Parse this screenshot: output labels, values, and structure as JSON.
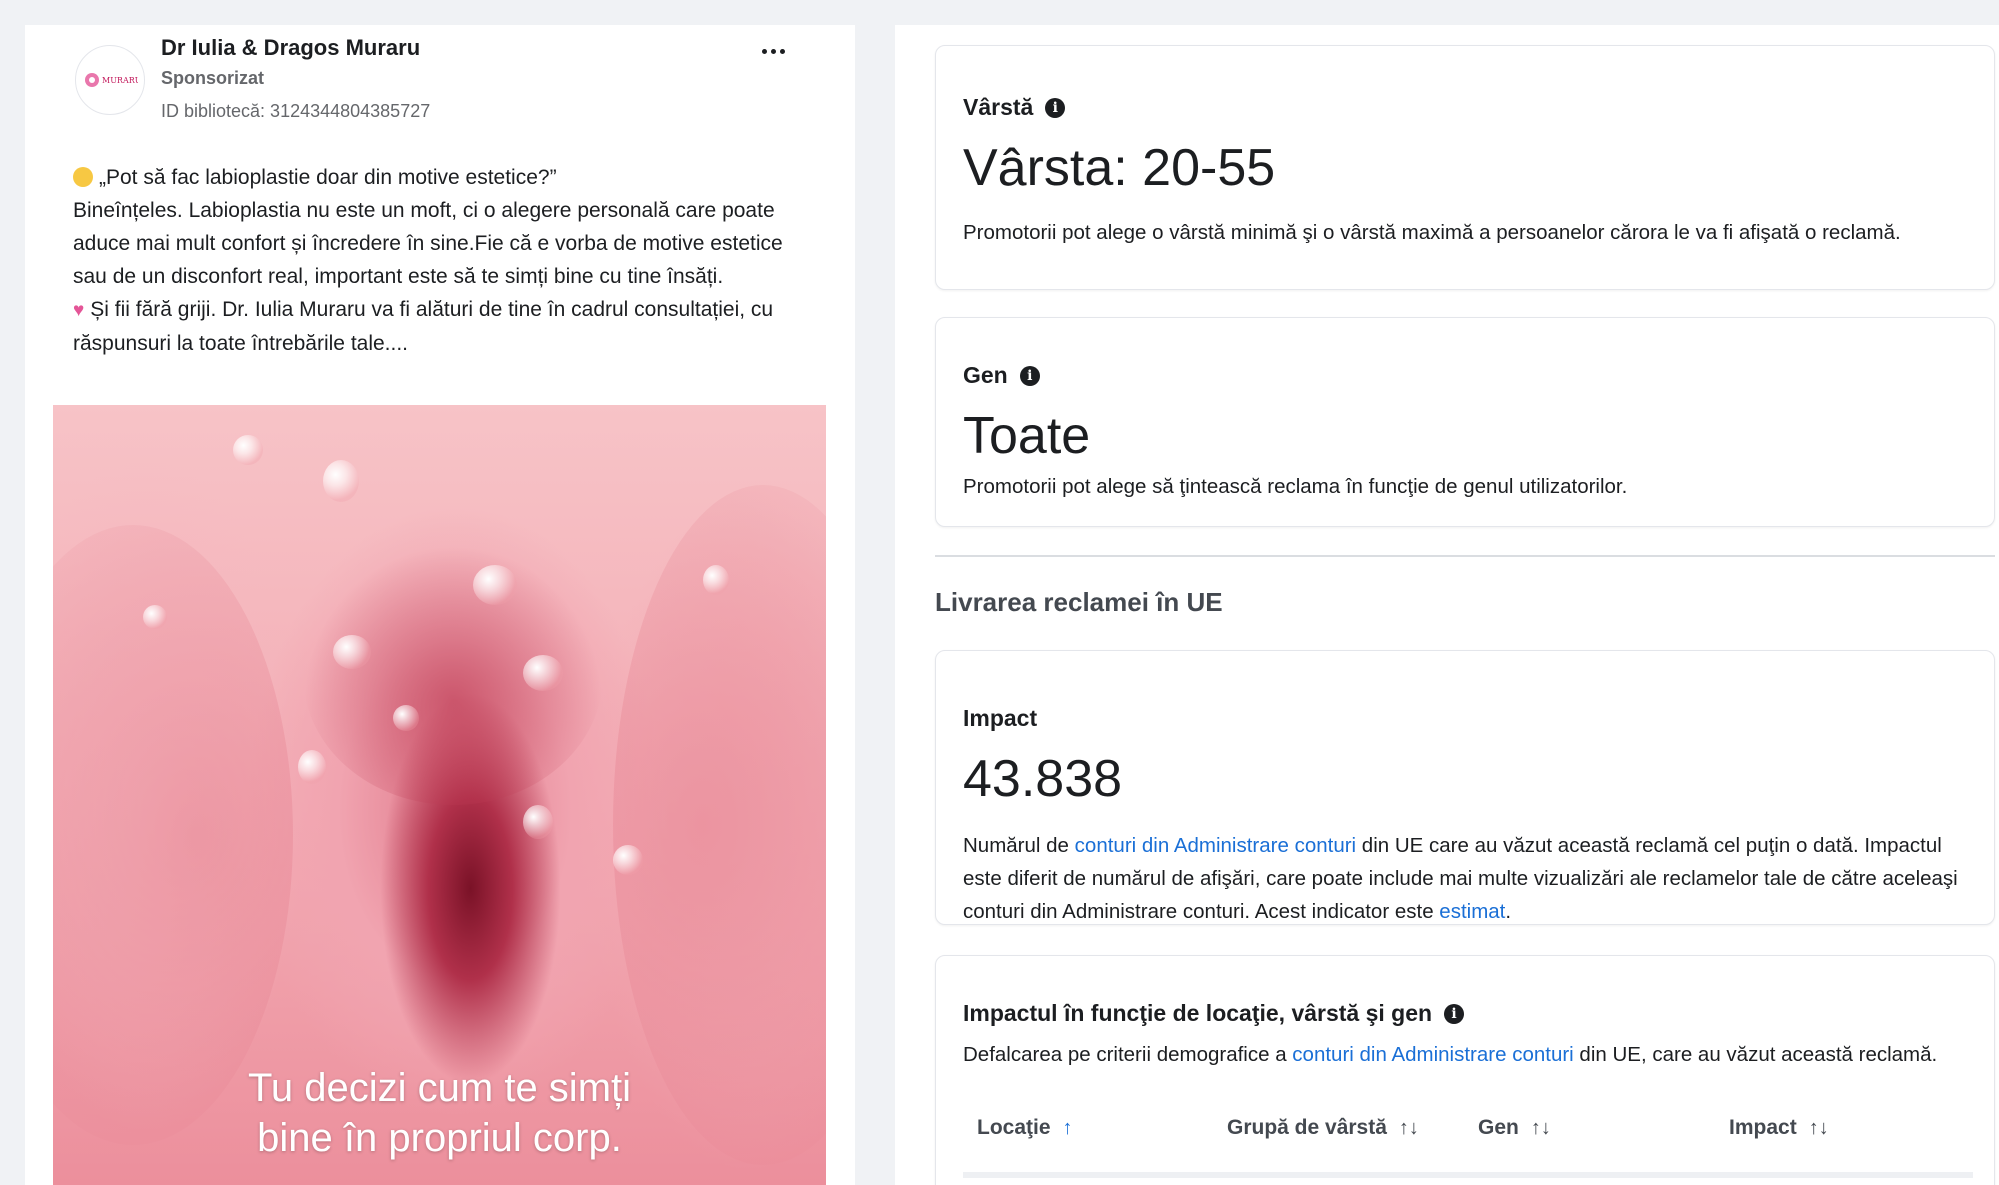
{
  "ad": {
    "page_name": "Dr Iulia & Dragos Muraru",
    "sponsored_label": "Sponsorizat",
    "library_id": "ID bibliotecă: 3124344804385727",
    "avatar_text": "MURARU",
    "line1": "„Pot să fac labioplastie doar din motive estetice?”",
    "line2": "Bineînțeles. Labioplastia nu este un moft, ci o alegere personală care poate aduce mai mult confort și încredere în sine.Fie că e vorba de motive estetice sau de un disconfort real, important este să te simți bine cu tine însăți.",
    "line3": "Și fii fără griji. Dr. Iulia Muraru va fi alături de tine în cadrul consultației, cu răspunsuri la toate întrebările tale....",
    "emoji1": "thinking-face",
    "emoji2": "pink-heart",
    "image_caption_line1": "Tu decizi cum te simți",
    "image_caption_line2": "bine în propriul corp."
  },
  "age": {
    "label": "Vârstă",
    "value": "Vârsta: 20-55",
    "description": "Promotorii pot alege o vârstă minimă şi o vârstă maximă a persoanelor cărora le va fi afişată o reclamă."
  },
  "gender": {
    "label": "Gen",
    "value": "Toate",
    "description": "Promotorii pot alege să ţintească reclama în funcţie de genul utilizatorilor."
  },
  "eu_delivery": {
    "title": "Livrarea reclamei în UE"
  },
  "impact": {
    "label": "Impact",
    "value": "43.838",
    "desc_part1": "Numărul de ",
    "desc_link1": "conturi din Administrare conturi",
    "desc_part2": " din UE care au văzut această reclamă cel puţin o dată. Impactul este diferit de numărul de afişări, care poate include mai multe vizualizări ale reclamelor tale de către aceleaşi conturi din Administrare conturi. Acest indicator este ",
    "desc_link2": "estimat",
    "desc_part3": "."
  },
  "breakdown": {
    "title": "Impactul în funcţie de locaţie, vârstă şi gen",
    "desc_part1": "Defalcarea pe criterii demografice a ",
    "desc_link": "conturi din Administrare conturi",
    "desc_part2": " din UE, care au văzut această reclamă.",
    "columns": [
      {
        "label": "Locaţie",
        "sort": "↑"
      },
      {
        "label": "Grupă de vârstă",
        "sort": "↑↓"
      },
      {
        "label": "Gen",
        "sort": "↑↓"
      },
      {
        "label": "Impact",
        "sort": "↑↓"
      }
    ]
  },
  "colors": {
    "link": "#1a6fd6",
    "text": "#1c1e21",
    "muted": "#65676b",
    "background": "#f0f2f5"
  }
}
